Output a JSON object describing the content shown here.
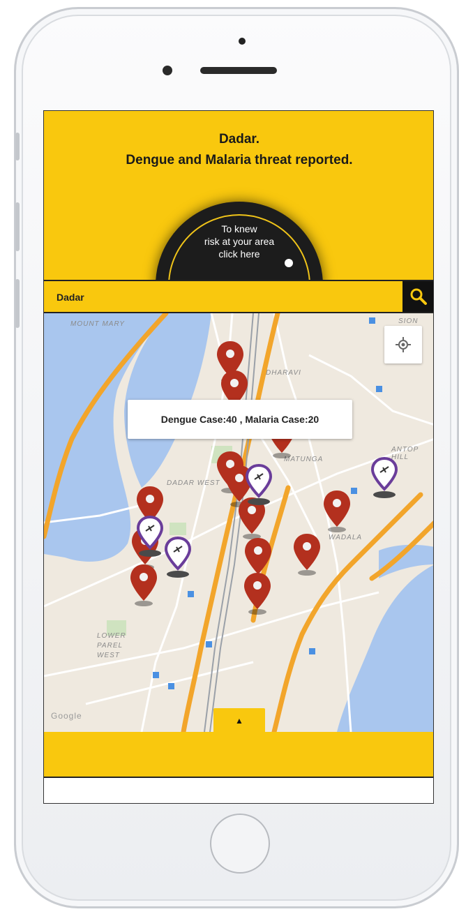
{
  "alert": {
    "area": "Dadar.",
    "message": "Dengue and Malaria threat reported."
  },
  "risk_button": {
    "line1": "To knew",
    "line2": "risk at your area",
    "line3": "click here"
  },
  "search": {
    "value": "Dadar",
    "icon": "search-icon"
  },
  "map": {
    "labels": [
      "MOUNT MARY",
      "DHARAVI",
      "MATUNGA",
      "DADAR WEST",
      "ANTOP HILL",
      "LOWER PAREL WEST",
      "WADALA",
      "SION",
      "Google"
    ],
    "tooltip": "Dengue Case:40 , Malaria Case:20",
    "locate_icon": "my-location-icon",
    "collapse_icon": "▲"
  },
  "colors": {
    "brand_yellow": "#f9c80e",
    "dengue_marker": "#b3301e",
    "malaria_marker": "#6a3d9a",
    "water": "#a9c6ee",
    "road_major": "#f2a52b"
  }
}
